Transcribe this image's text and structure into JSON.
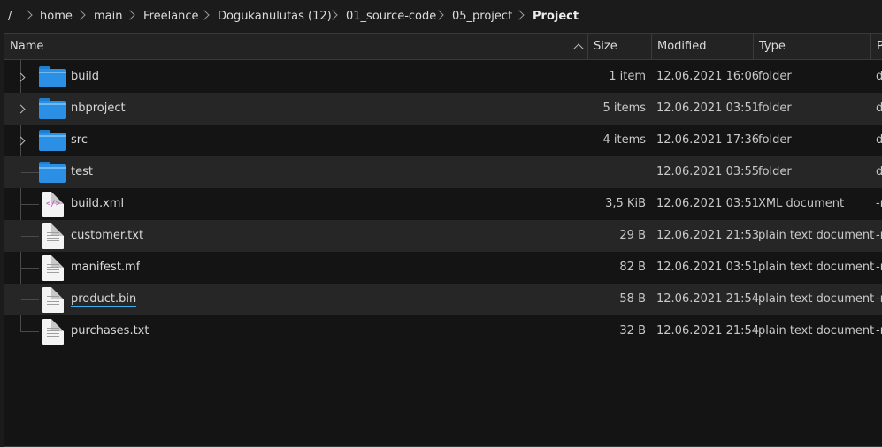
{
  "breadcrumb": [
    "/",
    "home",
    "main",
    "Freelance",
    "Dogukanulutas (12)",
    "01_source-code",
    "05_project",
    "Project"
  ],
  "columns": {
    "name": "Name",
    "size": "Size",
    "modified": "Modified",
    "type": "Type",
    "perm": "P"
  },
  "rows": [
    {
      "name": "build",
      "size": "1 item",
      "modified": "12.06.2021 16:06",
      "type": "folder",
      "perm": "d",
      "icon": "folder-icon",
      "expandable": true
    },
    {
      "name": "nbproject",
      "size": "5 items",
      "modified": "12.06.2021 03:51",
      "type": "folder",
      "perm": "d",
      "icon": "folder-icon",
      "expandable": true
    },
    {
      "name": "src",
      "size": "4 items",
      "modified": "12.06.2021 17:36",
      "type": "folder",
      "perm": "d",
      "icon": "folder-icon",
      "expandable": true
    },
    {
      "name": "test",
      "size": "",
      "modified": "12.06.2021 03:55",
      "type": "folder",
      "perm": "d",
      "icon": "folder-icon",
      "expandable": false
    },
    {
      "name": "build.xml",
      "size": "3,5 KiB",
      "modified": "12.06.2021 03:51",
      "type": "XML document",
      "perm": "-r",
      "icon": "xml-file-icon",
      "expandable": false
    },
    {
      "name": "customer.txt",
      "size": "29 B",
      "modified": "12.06.2021 21:53",
      "type": "plain text document",
      "perm": "-r",
      "icon": "text-file-icon",
      "expandable": false
    },
    {
      "name": "manifest.mf",
      "size": "82 B",
      "modified": "12.06.2021 03:51",
      "type": "plain text document",
      "perm": "-r",
      "icon": "text-file-icon",
      "expandable": false
    },
    {
      "name": "product.bin",
      "size": "58 B",
      "modified": "12.06.2021 21:54",
      "type": "plain text document",
      "perm": "-r",
      "icon": "text-file-icon",
      "expandable": false
    },
    {
      "name": "purchases.txt",
      "size": "32 B",
      "modified": "12.06.2021 21:54",
      "type": "plain text document",
      "perm": "-r",
      "icon": "text-file-icon",
      "expandable": false
    }
  ],
  "xml_glyph": "</>",
  "colors": {
    "background": "#141414",
    "alt_row": "#262626",
    "folder": "#2b8fe3",
    "xml_accent": "#c74ec7",
    "hover_underline": "#3daee9"
  }
}
